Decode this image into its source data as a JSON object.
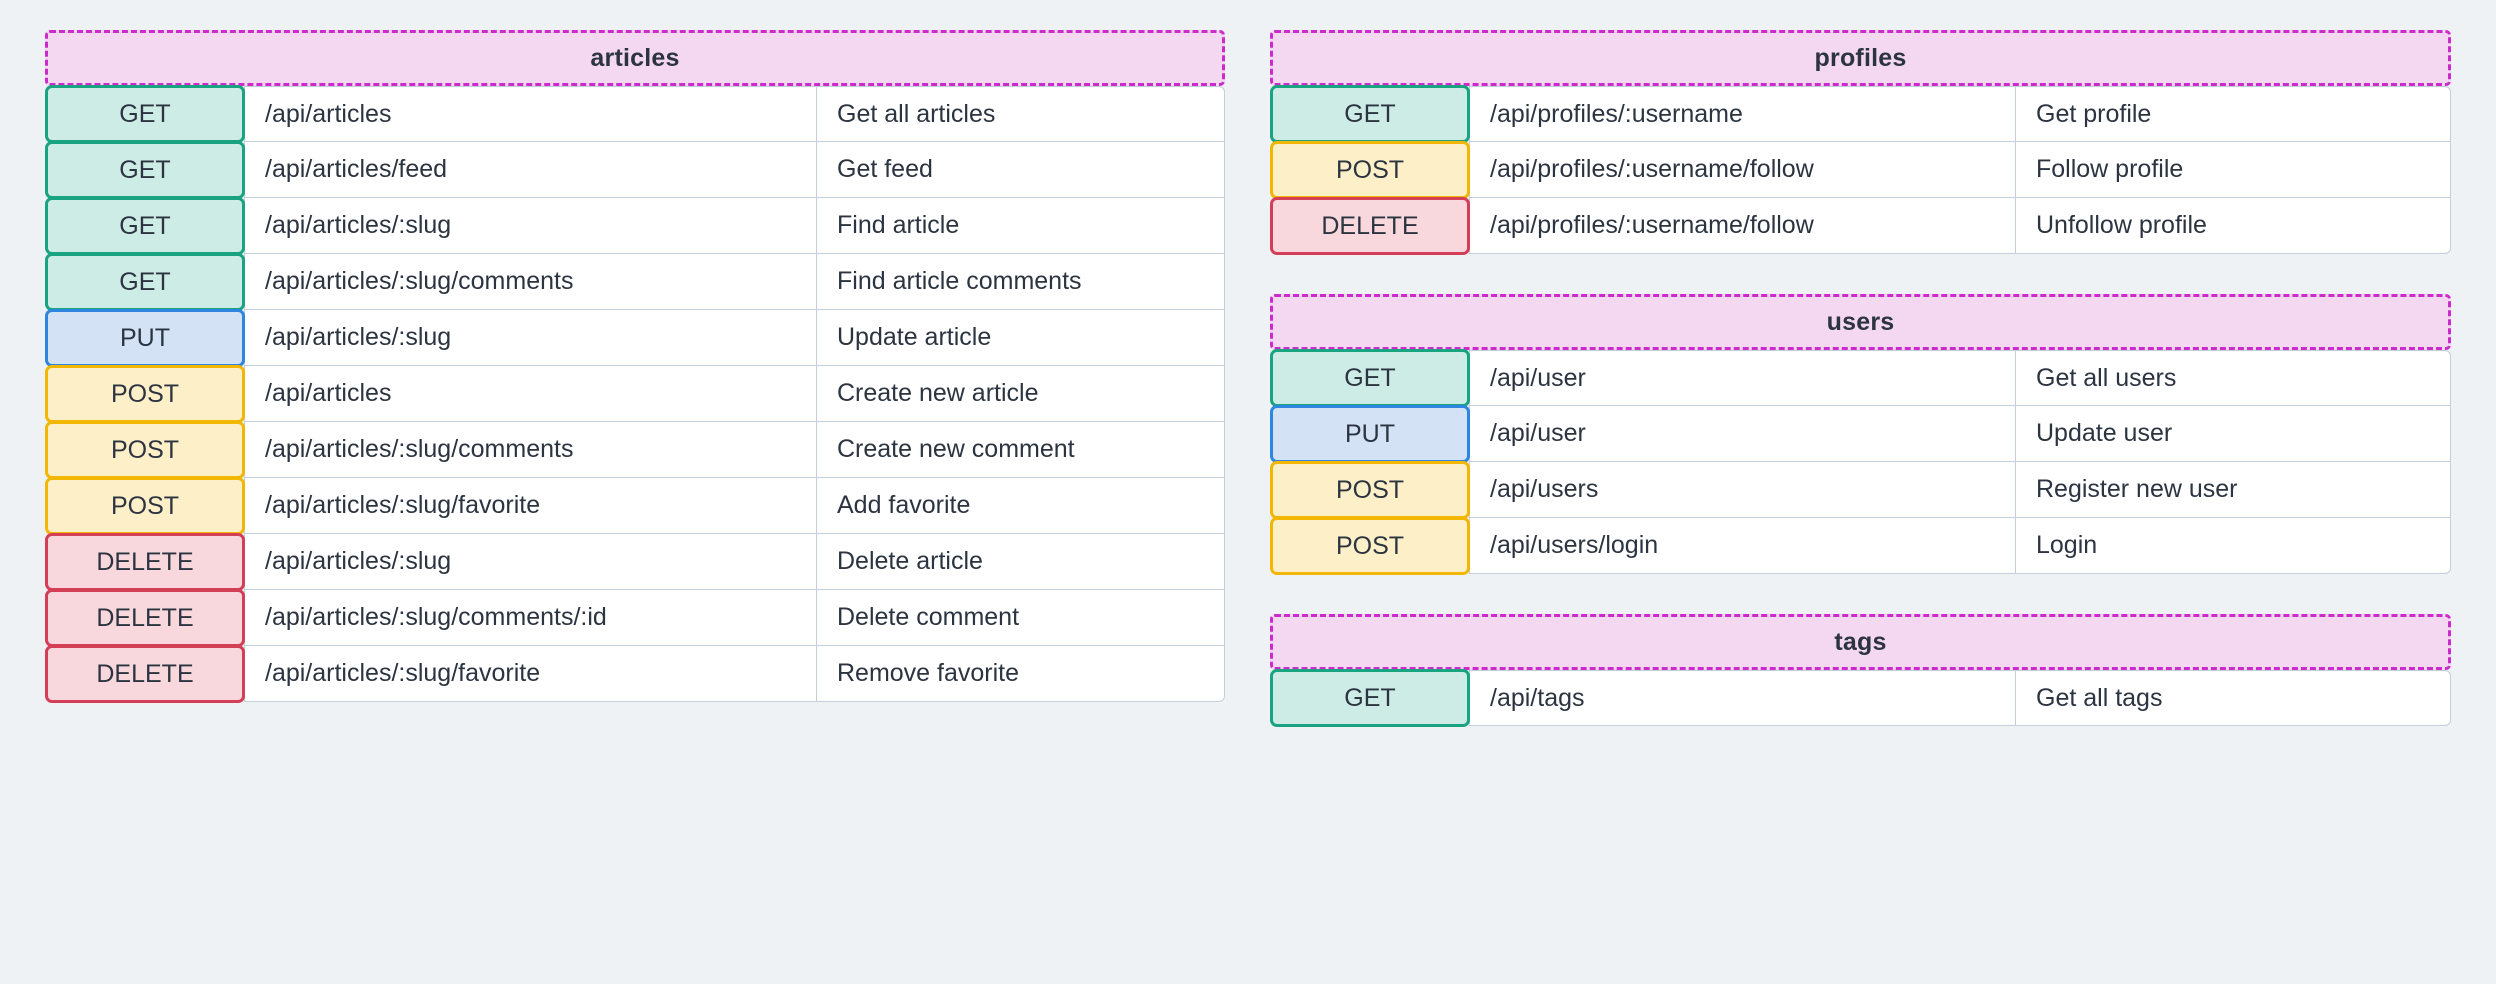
{
  "theme": {
    "background": "#eef2f5",
    "group_header_fill": "#f4d7f0",
    "group_header_border": "#cc2bcc",
    "text": "#2b3440",
    "cell_border": "#c3cfda",
    "method_colors": {
      "GET": {
        "fill": "#cdece6",
        "border": "#1aa380"
      },
      "PUT": {
        "fill": "#d3e2f4",
        "border": "#2e86de"
      },
      "POST": {
        "fill": "#fdf0c8",
        "border": "#f2b705"
      },
      "DELETE": {
        "fill": "#f8d7dd",
        "border": "#d43f58"
      }
    }
  },
  "columns": [
    {
      "name": "left-column",
      "groups": [
        {
          "title": "articles",
          "endpoints": [
            {
              "method": "GET",
              "path": "/api/articles",
              "description": "Get all articles"
            },
            {
              "method": "GET",
              "path": "/api/articles/feed",
              "description": "Get feed"
            },
            {
              "method": "GET",
              "path": "/api/articles/:slug",
              "description": "Find article"
            },
            {
              "method": "GET",
              "path": "/api/articles/:slug/comments",
              "description": "Find article comments"
            },
            {
              "method": "PUT",
              "path": "/api/articles/:slug",
              "description": "Update article"
            },
            {
              "method": "POST",
              "path": "/api/articles",
              "description": "Create new article"
            },
            {
              "method": "POST",
              "path": "/api/articles/:slug/comments",
              "description": "Create new comment"
            },
            {
              "method": "POST",
              "path": "/api/articles/:slug/favorite",
              "description": "Add favorite"
            },
            {
              "method": "DELETE",
              "path": "/api/articles/:slug",
              "description": "Delete article"
            },
            {
              "method": "DELETE",
              "path": "/api/articles/:slug/comments/:id",
              "description": "Delete comment"
            },
            {
              "method": "DELETE",
              "path": "/api/articles/:slug/favorite",
              "description": "Remove favorite"
            }
          ]
        }
      ]
    },
    {
      "name": "right-column",
      "groups": [
        {
          "title": "profiles",
          "endpoints": [
            {
              "method": "GET",
              "path": "/api/profiles/:username",
              "description": "Get profile"
            },
            {
              "method": "POST",
              "path": "/api/profiles/:username/follow",
              "description": "Follow profile"
            },
            {
              "method": "DELETE",
              "path": "/api/profiles/:username/follow",
              "description": "Unfollow profile"
            }
          ]
        },
        {
          "title": "users",
          "endpoints": [
            {
              "method": "GET",
              "path": "/api/user",
              "description": "Get all users"
            },
            {
              "method": "PUT",
              "path": "/api/user",
              "description": "Update user"
            },
            {
              "method": "POST",
              "path": "/api/users",
              "description": "Register new user"
            },
            {
              "method": "POST",
              "path": "/api/users/login",
              "description": "Login"
            }
          ]
        },
        {
          "title": "tags",
          "endpoints": [
            {
              "method": "GET",
              "path": "/api/tags",
              "description": "Get all tags"
            }
          ]
        }
      ]
    }
  ]
}
